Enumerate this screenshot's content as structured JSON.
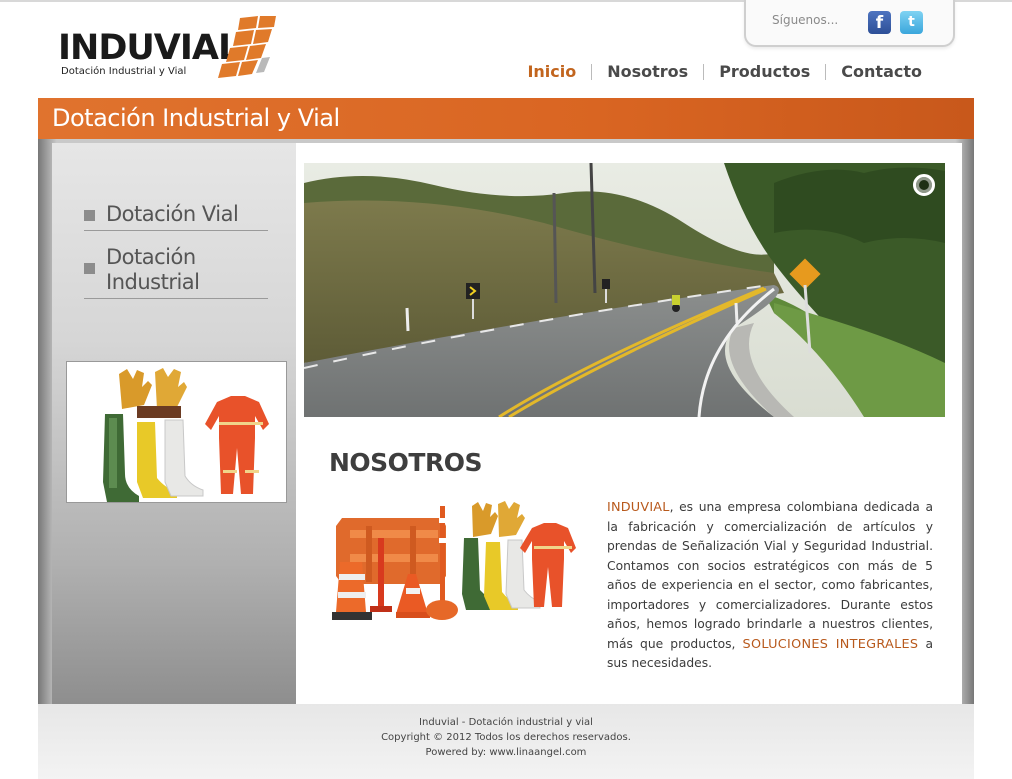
{
  "brand": {
    "name": "INDUVIAL",
    "tagline": "Dotación Industrial y Vial"
  },
  "social": {
    "label": "Síguenos...",
    "facebook_glyph": "f",
    "twitter_glyph": "t",
    "icons": [
      "facebook-icon",
      "twitter-icon"
    ]
  },
  "nav": {
    "items": [
      {
        "label": "Inicio",
        "active": true
      },
      {
        "label": "Nosotros",
        "active": false
      },
      {
        "label": "Productos",
        "active": false
      },
      {
        "label": "Contacto",
        "active": false
      }
    ]
  },
  "banner": {
    "title": "Dotación Industrial y Vial"
  },
  "sidebar": {
    "menu": [
      {
        "label": "Dotación Vial"
      },
      {
        "label_line1": "Dotación",
        "label_line2": "Industrial"
      }
    ]
  },
  "main": {
    "section_title": "NOSOTROS",
    "about": {
      "brand": "INDUVIAL",
      "text_1": ", es una empresa colombiana dedicada a la fabricación y comercialización de artículos y prendas de Señalización Vial y Seguridad Industrial. Contamos con socios estratégicos con más de 5 años de experiencia en el sector, como fabricantes, importadores y comercializadores. Durante estos años, hemos logrado brindarle a nuestros clientes, más que productos,",
      "highlight": "SOLUCIONES INTEGRALES",
      "text_2": " a sus necesidades."
    }
  },
  "footer": {
    "line1": "Induvial - Dotación industrial y vial",
    "line2": "Copyright © 2012 Todos los derechos reservados.",
    "line3": "Powered by: www.linaangel.com"
  },
  "colors": {
    "accent": "#d96522",
    "nav_active": "#c2651e",
    "text": "#4a4a4a"
  }
}
